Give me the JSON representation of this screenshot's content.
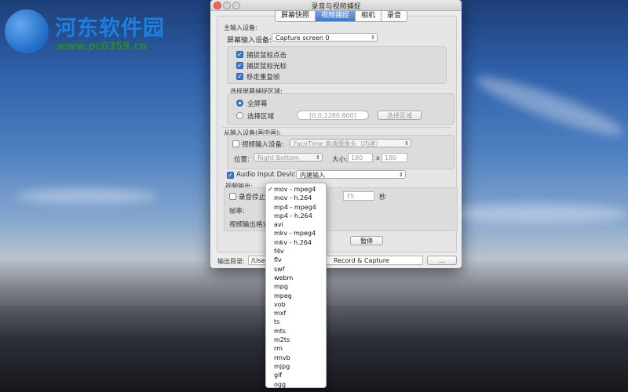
{
  "watermark": {
    "site_name": "河东软件园",
    "url": "www.pc0359.cn"
  },
  "window": {
    "title": "录音与视频捕捉"
  },
  "tabs": [
    {
      "label": "屏幕快照",
      "active": false
    },
    {
      "label": "视频捕捉",
      "active": true
    },
    {
      "label": "相机",
      "active": false
    },
    {
      "label": "录音",
      "active": false
    }
  ],
  "main_input": {
    "section_label": "主输入设备:",
    "device_label": "屏幕输入设备:",
    "device_value": "Capture screen 0",
    "capture_clicks": {
      "label": "捕捉鼠标点击",
      "checked": true
    },
    "capture_cursor": {
      "label": "捕捉鼠标光标",
      "checked": true
    },
    "remove_dup": {
      "label": "移走重复帧",
      "checked": true
    }
  },
  "region": {
    "section_label": "选择屏幕捕捉区域:",
    "full_screen": {
      "label": "全屏幕",
      "selected": true
    },
    "select_area": {
      "label": "选择区域",
      "selected": false
    },
    "coords": "[0,0,1280,800]",
    "select_button": "选择区域"
  },
  "pip": {
    "section_label": "从输入设备(画中画):",
    "video_input": {
      "label": "视频输入设备:",
      "checked": false
    },
    "camera_value": "FaceTime 高清摄像头（内建）",
    "position_label": "位置:",
    "position_value": "Right Bottom",
    "size_label": "大小:",
    "width": "180",
    "times": "x",
    "height": "180"
  },
  "audio": {
    "label": "Audio Input Devices:",
    "checked": true,
    "value": "内建输入"
  },
  "video_output": {
    "section_label": "视频输出:",
    "stop_label": "录音停止时",
    "stop_checked": false,
    "seconds_value": "75",
    "seconds_unit": "秒",
    "fps_label": "帧率:",
    "format_label": "视频输出格式:"
  },
  "pause_button": "暂停",
  "output_dir": {
    "label": "输出目录:",
    "path_start": "/User",
    "path_end": "Record & Capture",
    "browse_button": "..."
  },
  "format_menu": {
    "selected": "mov - mpeg4",
    "checkmark": "✓",
    "items": [
      "mov - mpeg4",
      "mov - h.264",
      "mp4 - mpeg4",
      "mp4 - h.264",
      "avi",
      "mkv - mpeg4",
      "mkv - h.264",
      "f4v",
      "flv",
      "swf",
      "webm",
      "mpg",
      "mpeg",
      "vob",
      "mxf",
      "ts",
      "mts",
      "m2ts",
      "rm",
      "rmvb",
      "mjpg",
      "gif",
      "ogg"
    ]
  }
}
